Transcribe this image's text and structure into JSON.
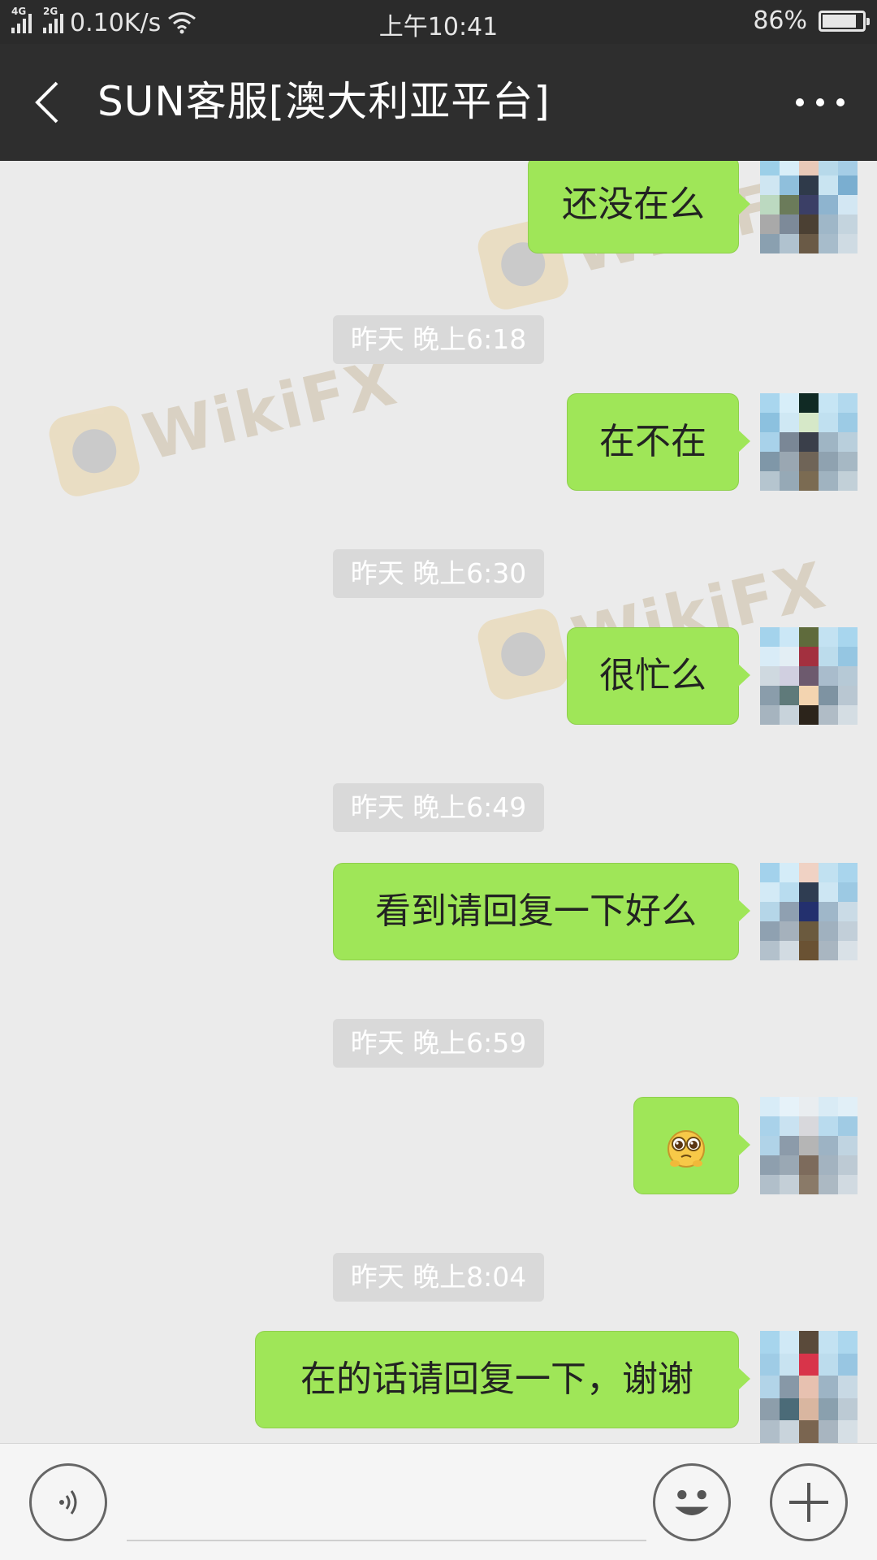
{
  "status_bar": {
    "network_1": "4G",
    "network_2": "2G",
    "speed": "0.10K/s",
    "time": "上午10:41",
    "battery": "86%",
    "battery_level": 0.86
  },
  "header": {
    "title": "SUN客服[澳大利亚平台]"
  },
  "messages": [
    {
      "text": "还没在么"
    },
    {
      "timestamp": "昨天 晚上6:18",
      "text": "在不在"
    },
    {
      "timestamp": "昨天 晚上6:30",
      "text": "很忙么"
    },
    {
      "timestamp": "昨天 晚上6:49",
      "text": "看到请回复一下好么"
    },
    {
      "timestamp": "昨天 晚上6:59",
      "text": "",
      "emoji": "pleading-face-emoji"
    },
    {
      "timestamp": "昨天 晚上8:04",
      "text": "在的话请回复一下，谢谢"
    }
  ],
  "watermark": "WikiFX",
  "input_bar": {
    "voice_icon": "voice-icon",
    "emoji_icon": "emoji-icon",
    "plus_icon": "plus-icon"
  },
  "colors": {
    "bubble": "#9fe658",
    "header": "#2e2e2e",
    "chat_bg": "#ebebeb"
  }
}
